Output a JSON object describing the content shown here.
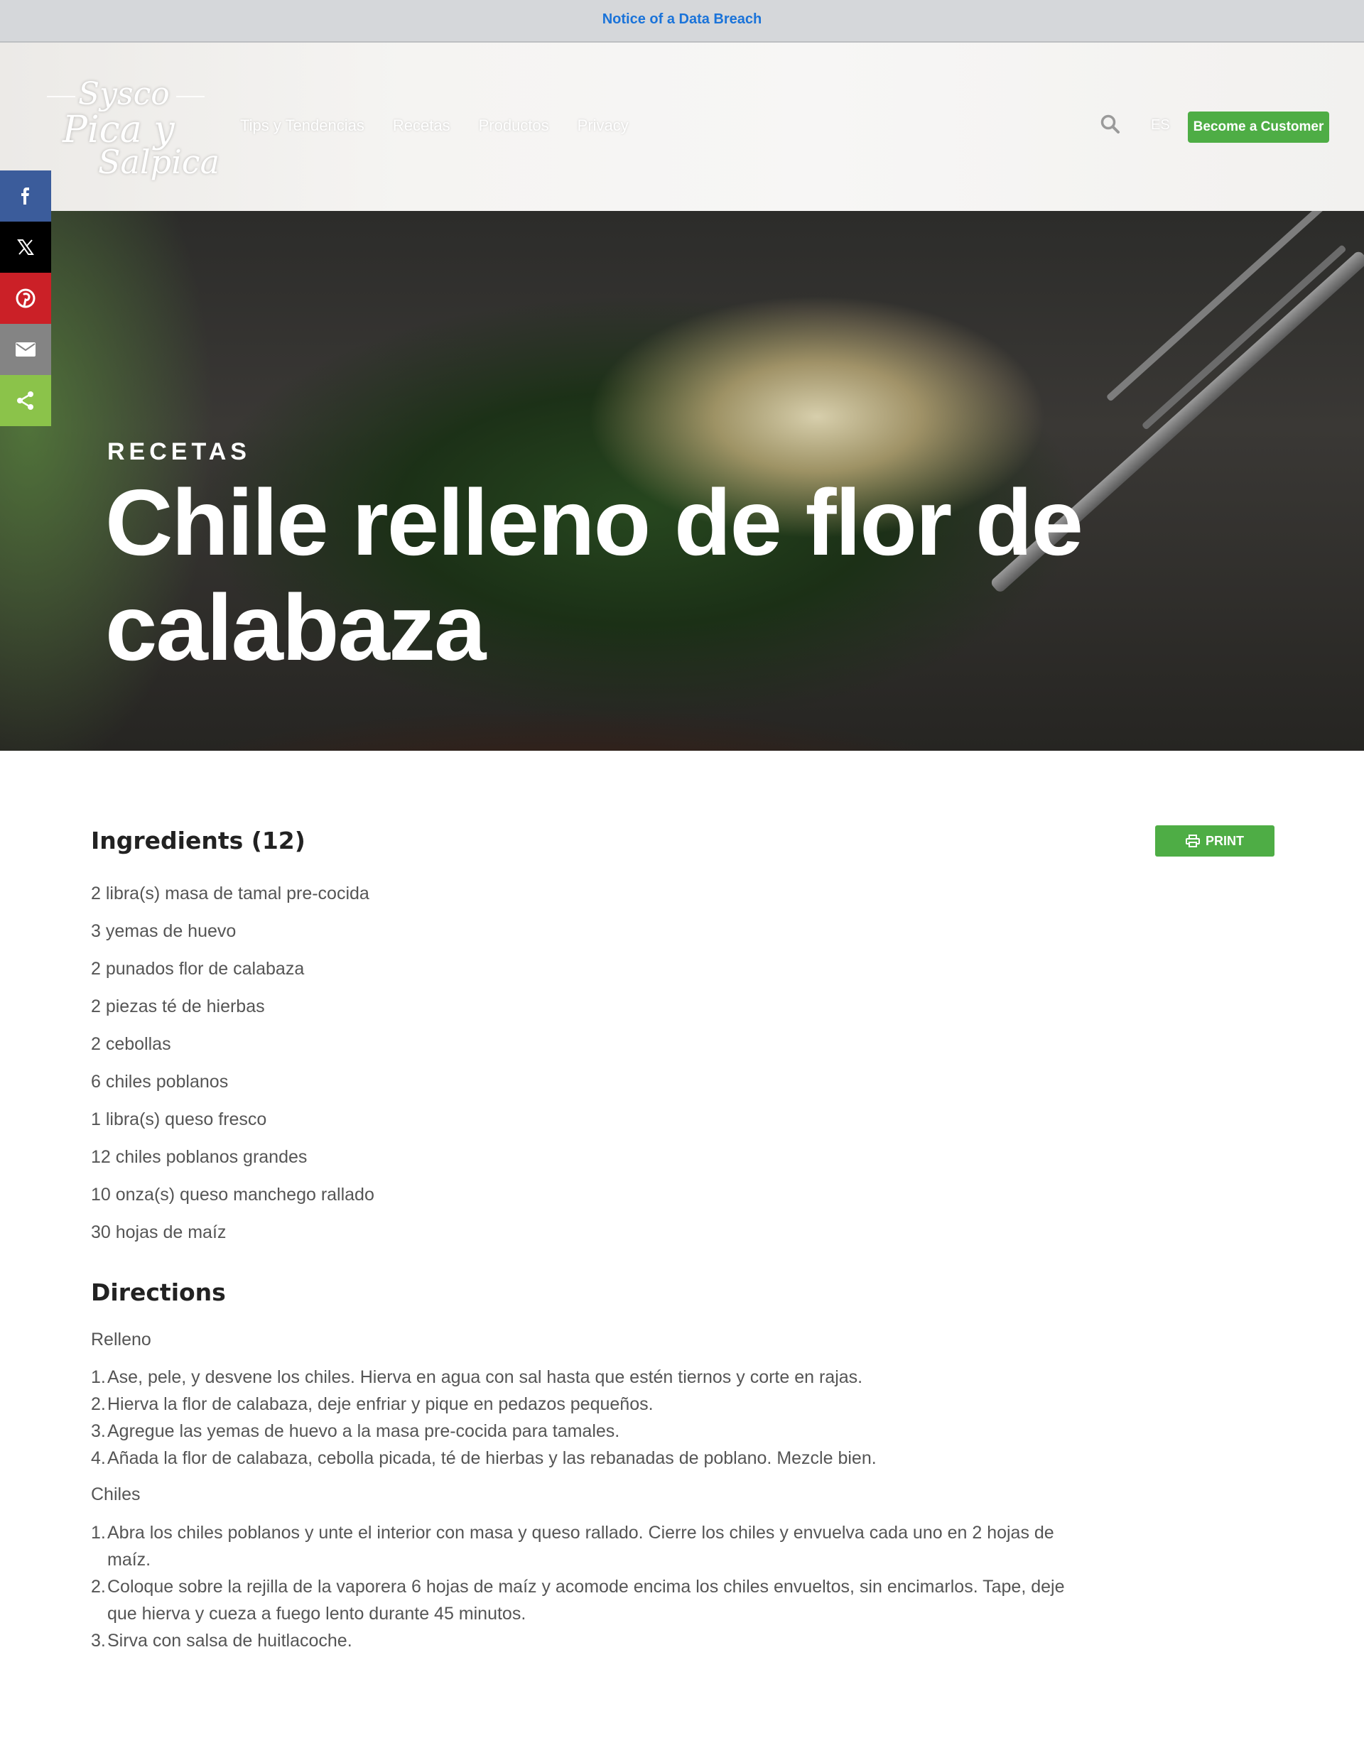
{
  "notice": {
    "text": "Notice of a Data Breach"
  },
  "logo": {
    "line1": "Sysco",
    "line2": "Pica y",
    "line3": "Salpica"
  },
  "nav": {
    "items": [
      "Tips y Tendencias",
      "Recetas",
      "Productos",
      "Privacy"
    ]
  },
  "header": {
    "search_icon": "search-icon",
    "lang": "ES",
    "become_label": "Become a Customer"
  },
  "share": {
    "items": [
      {
        "name": "facebook",
        "icon": "facebook-icon",
        "color": "#3b5c9b"
      },
      {
        "name": "x",
        "icon": "x-icon",
        "color": "#000000"
      },
      {
        "name": "pinterest",
        "icon": "pinterest-icon",
        "color": "#cb2027"
      },
      {
        "name": "email",
        "icon": "email-icon",
        "color": "#848484"
      },
      {
        "name": "share",
        "icon": "share-icon",
        "color": "#8bc34a"
      }
    ]
  },
  "hero": {
    "kicker": "RECETAS",
    "title": "Chile relleno de flor de calabaza"
  },
  "ingredients": {
    "title": "Ingredients (12)",
    "print_label": "PRINT",
    "items": [
      "2 libra(s) masa de tamal pre-cocida",
      "3 yemas de huevo",
      "2 punados flor de calabaza",
      "2 piezas té de hierbas",
      "2 cebollas",
      "6 chiles poblanos",
      "1 libra(s) queso fresco",
      "12 chiles poblanos grandes",
      "10 onza(s) queso manchego rallado",
      "30 hojas de maíz"
    ]
  },
  "directions": {
    "title": "Directions",
    "sections": [
      {
        "name": "Relleno",
        "steps": [
          "Ase, pele, y desvene los chiles. Hierva en agua con sal hasta que estén tiernos y corte en rajas.",
          "Hierva la flor de calabaza, deje enfriar y pique en pedazos pequeños.",
          "Agregue las yemas de huevo a la masa pre-cocida para tamales.",
          "Añada la flor de calabaza, cebolla picada, té de hierbas y las rebanadas de poblano. Mezcle bien."
        ]
      },
      {
        "name": "Chiles",
        "steps": [
          "Abra los chiles poblanos y unte el interior con masa y queso rallado. Cierre los chiles y envuelva cada uno en 2 hojas de maíz.",
          "Coloque sobre la rejilla de la vaporera 6 hojas de maíz y acomode encima los chiles envueltos, sin encimarlos. Tape, deje que hierva y cueza a fuego lento durante 45 minutos.",
          "Sirva con salsa de huitlacoche."
        ]
      }
    ]
  },
  "colors": {
    "accent_green": "#4ead45",
    "link_blue": "#1a73d9"
  }
}
